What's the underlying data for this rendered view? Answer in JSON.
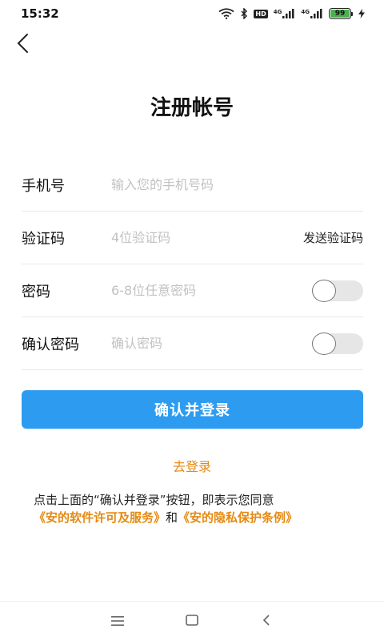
{
  "status_bar": {
    "time": "15:32",
    "hd_label": "HD",
    "network_1": "4G",
    "network_2": "4G",
    "battery_level": "99",
    "icons": [
      "wifi-icon",
      "bluetooth-icon",
      "signal-icon",
      "signal-icon",
      "battery-icon",
      "charging-icon"
    ]
  },
  "header": {
    "back_icon": "chevron-left-icon",
    "title": "注册帐号"
  },
  "form": {
    "phone": {
      "label": "手机号",
      "placeholder": "输入您的手机号码",
      "value": ""
    },
    "code": {
      "label": "验证码",
      "placeholder": "4位验证码",
      "value": "",
      "send_label": "发送验证码"
    },
    "password": {
      "label": "密码",
      "placeholder": "6-8位任意密码",
      "value": "",
      "visible": false
    },
    "confirm_password": {
      "label": "确认密码",
      "placeholder": "确认密码",
      "value": "",
      "visible": false
    }
  },
  "submit_label": "确认并登录",
  "goto_login_label": "去登录",
  "agreement": {
    "prefix": "点击上面的“确认并登录”按钮，即表示您同意",
    "license_link": "《安的软件许可及服务》",
    "conjunction": "和",
    "privacy_link": "《安的隐私保护条例》"
  },
  "colors": {
    "accent": "#2d9cf0",
    "link": "#e58a13",
    "battery": "#4caf50"
  },
  "nav_bar": {
    "icons": [
      "menu-icon",
      "home-square-icon",
      "back-triangle-icon"
    ]
  }
}
